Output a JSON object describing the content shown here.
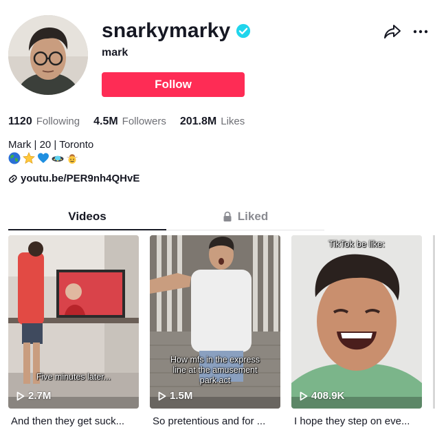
{
  "profile": {
    "username": "snarkymarky",
    "nickname": "mark",
    "follow_label": "Follow",
    "bio": "Mark | 20 | Toronto",
    "emojis": [
      "globe-emoji",
      "star-emoji",
      "blue-heart-emoji",
      "ufo-emoji",
      "cowboy-face-emoji"
    ],
    "link": "youtu.be/PER9nh4QHvE",
    "verified": true
  },
  "stats": {
    "following_count": "1120",
    "following_label": "Following",
    "followers_count": "4.5M",
    "followers_label": "Followers",
    "likes_count": "201.8M",
    "likes_label": "Likes"
  },
  "tabs": {
    "videos": "Videos",
    "liked": "Liked",
    "active": "videos"
  },
  "videos": [
    {
      "overlay": "Five minutes later...",
      "views": "2.7M",
      "caption": "And then they get suck..."
    },
    {
      "overlay": "How mfs in the express line at the amusement park act",
      "views": "1.5M",
      "caption": "So pretentious and for ..."
    },
    {
      "overlay": "TikTok be like:",
      "views": "408.9K",
      "caption": "I hope they step on eve..."
    }
  ],
  "colors": {
    "accent": "#fe2c55",
    "verified": "#20d5ec",
    "text": "#161823",
    "muted": "#6e6f75"
  }
}
